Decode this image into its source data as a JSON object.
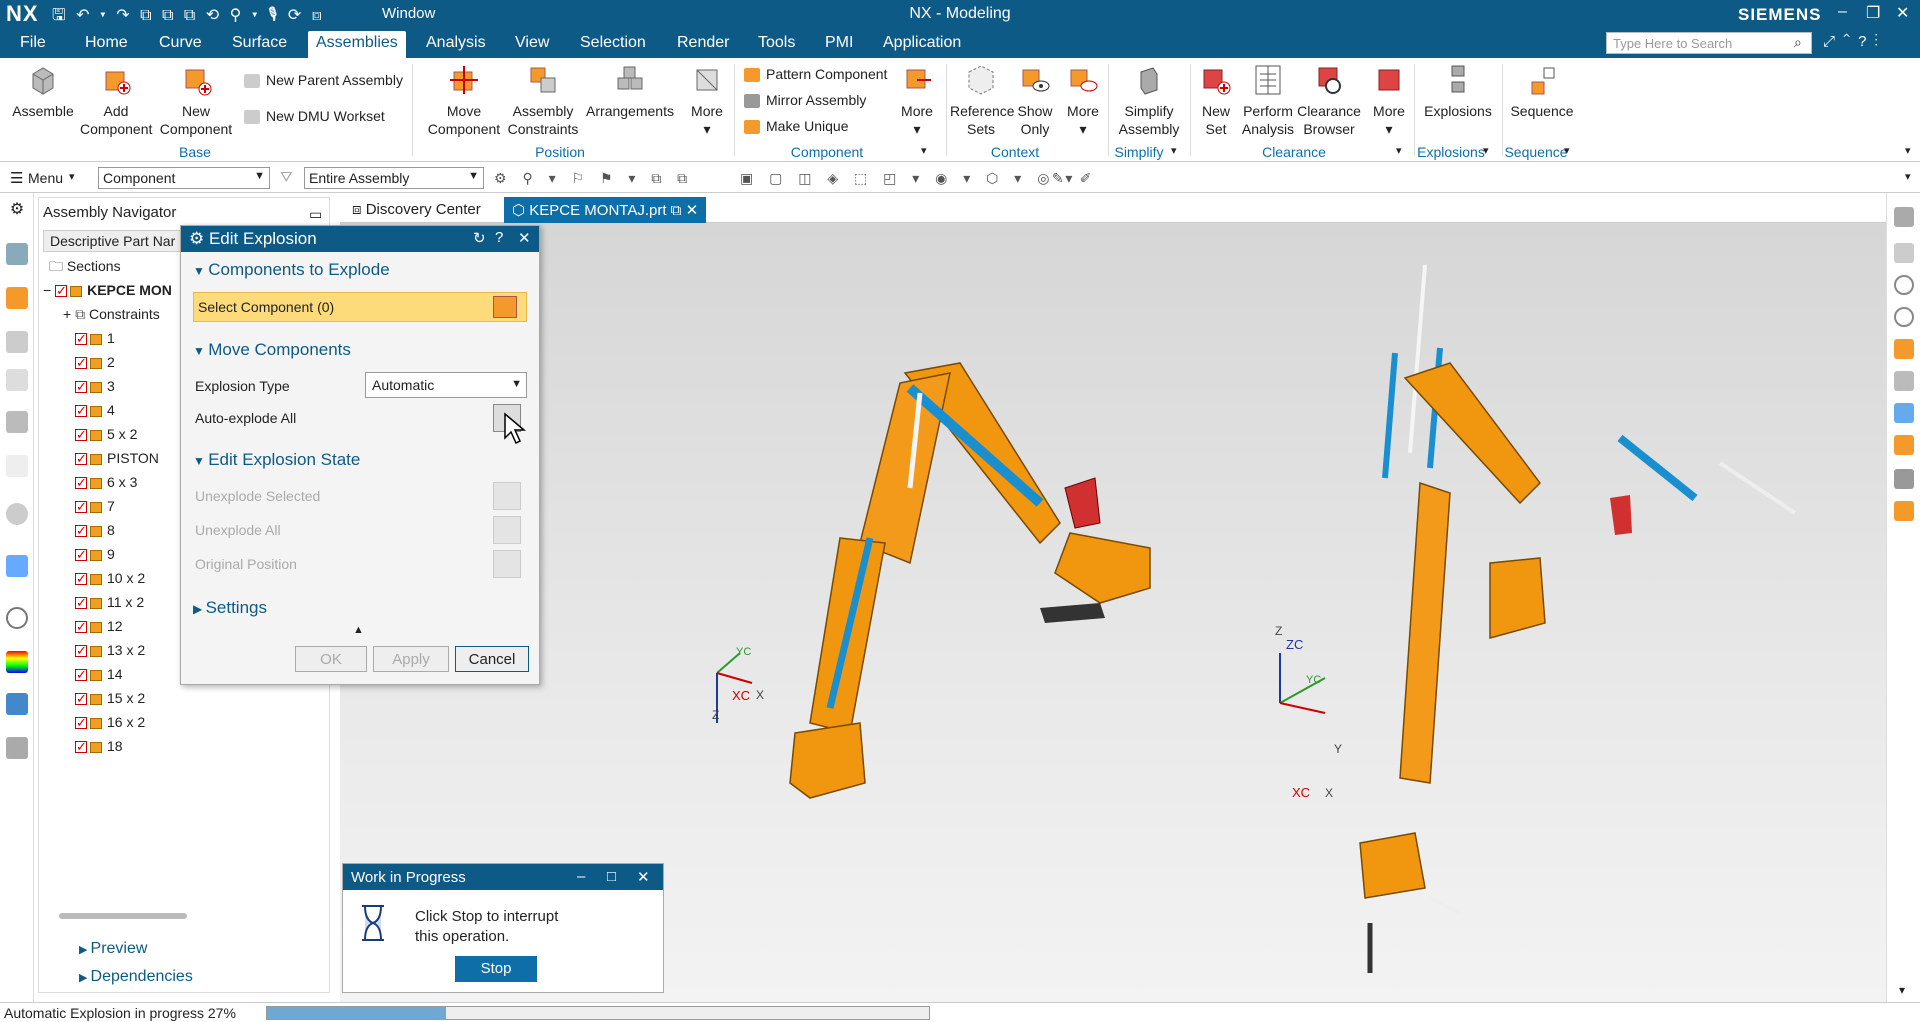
{
  "app": {
    "logo": "NX",
    "title": "NX - Modeling",
    "brand": "SIEMENS",
    "window_menu": "Window"
  },
  "menu": {
    "tabs": [
      "File",
      "Home",
      "Curve",
      "Surface",
      "Assemblies",
      "Analysis",
      "View",
      "Selection",
      "Render",
      "Tools",
      "PMI",
      "Application"
    ],
    "active": "Assemblies",
    "search_placeholder": "Type Here to Search"
  },
  "ribbon": {
    "assemble": "Assemble",
    "add_component": [
      "Add",
      "Component"
    ],
    "new_component": [
      "New",
      "Component"
    ],
    "new_parent_assembly": "New Parent Assembly",
    "new_dmu_workset": "New DMU Workset",
    "base_group": "Base",
    "move_component": [
      "Move",
      "Component"
    ],
    "assembly_constraints": [
      "Assembly",
      "Constraints"
    ],
    "arrangements": "Arrangements",
    "more": "More",
    "position_group": "Position",
    "pattern_component": "Pattern Component",
    "mirror_assembly": "Mirror Assembly",
    "make_unique": "Make Unique",
    "component_group": "Component",
    "reference_sets": [
      "Reference",
      "Sets"
    ],
    "show_only": [
      "Show",
      "Only"
    ],
    "context_group": "Context",
    "simplify_assembly": [
      "Simplify",
      "Assembly"
    ],
    "simplify_group": "Simplify",
    "new_set": [
      "New",
      "Set"
    ],
    "perform_analysis": [
      "Perform",
      "Analysis"
    ],
    "clearance_browser": [
      "Clearance",
      "Browser"
    ],
    "clearance_group": "Clearance",
    "explosions": "Explosions",
    "explosions_group": "Explosions",
    "sequence": "Sequence",
    "sequence_group": "Sequence"
  },
  "toolbar": {
    "menu_label": "Menu",
    "filter": "Component",
    "scope": "Entire Assembly"
  },
  "navigator": {
    "title": "Assembly Navigator",
    "column": "Descriptive Part Nar",
    "sections": "Sections",
    "root": "KEPCE MON",
    "constraints": "Constraints",
    "items": [
      "1",
      "2",
      "3",
      "4",
      "5 x 2",
      "PISTON",
      "6 x 3",
      "7",
      "8",
      "9",
      "10 x 2",
      "11 x 2",
      "12",
      "13 x 2",
      "14",
      "15 x 2",
      "16 x 2",
      "18"
    ],
    "preview": "Preview",
    "dependencies": "Dependencies"
  },
  "doc_tabs": {
    "discovery": "Discovery Center",
    "part": "KEPCE MONTAJ.prt"
  },
  "dialog": {
    "title": "Edit Explosion",
    "sec_components": "Components to Explode",
    "select_component": "Select Component (0)",
    "sec_move": "Move Components",
    "explosion_type_label": "Explosion Type",
    "explosion_type_value": "Automatic",
    "auto_explode": "Auto-explode All",
    "sec_state": "Edit Explosion State",
    "unexplode_selected": "Unexplode Selected",
    "unexplode_all": "Unexplode All",
    "original_position": "Original Position",
    "sec_settings": "Settings",
    "ok": "OK",
    "apply": "Apply",
    "cancel": "Cancel"
  },
  "wip": {
    "title": "Work in Progress",
    "message_1": "Click Stop to interrupt",
    "message_2": "this operation.",
    "stop": "Stop"
  },
  "viewport": {
    "axes_left": {
      "z": "Z",
      "xc": "XC",
      "x": "X",
      "yc": "YC"
    },
    "axes_right": {
      "zc": "ZC",
      "z": "Z",
      "yc": "YC",
      "y": "Y",
      "xc": "XC",
      "x": "X"
    }
  },
  "status": {
    "text": "Automatic Explosion in progress 27%",
    "progress": 0.27
  },
  "colors": {
    "accent": "#0e5a87",
    "part_orange": "#f0960f",
    "cylinder_blue": "#1a8fd0"
  }
}
